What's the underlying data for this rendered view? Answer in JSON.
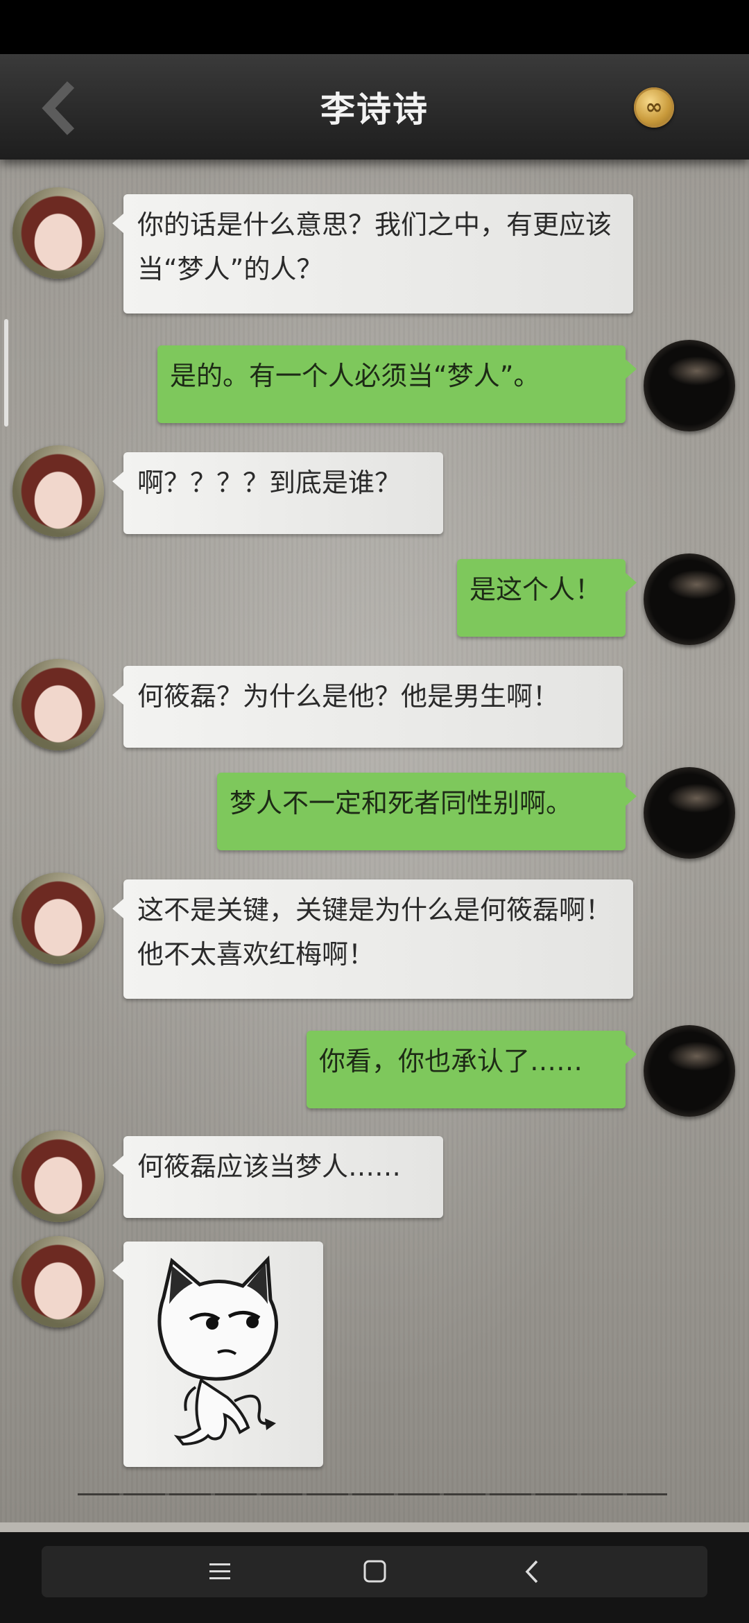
{
  "header": {
    "title": "李诗诗"
  },
  "messages": [
    {
      "from": "her",
      "text": "你的话是什么意思？我们之中，有更应该当“梦人”的人？"
    },
    {
      "from": "me",
      "text": "是的。有一个人必须当“梦人”。"
    },
    {
      "from": "her",
      "text": "啊？？？？到底是谁？"
    },
    {
      "from": "me",
      "text": "是这个人！"
    },
    {
      "from": "her",
      "text": "何筱磊？为什么是他？他是男生啊！"
    },
    {
      "from": "me",
      "text": "梦人不一定和死者同性别啊。"
    },
    {
      "from": "her",
      "text": "这不是关键，关键是为什么是何筱磊啊！他不太喜欢红梅啊！"
    },
    {
      "from": "me",
      "text": "你看，你也承认了……"
    },
    {
      "from": "her",
      "text": "何筱磊应该当梦人……"
    },
    {
      "from": "her",
      "sticker": "cartoon-cat-devil-sticker"
    }
  ],
  "icons": {
    "back": "chevron-left-icon",
    "coin": "infinity-coin-icon",
    "nav_menu": "menu-icon",
    "nav_home": "square-home-icon",
    "nav_back": "chevron-left-icon"
  },
  "colors": {
    "outgoing_bubble": "#7ec85c",
    "incoming_bubble": "#f1f1ef",
    "header_bg": "#2a2a2a"
  }
}
